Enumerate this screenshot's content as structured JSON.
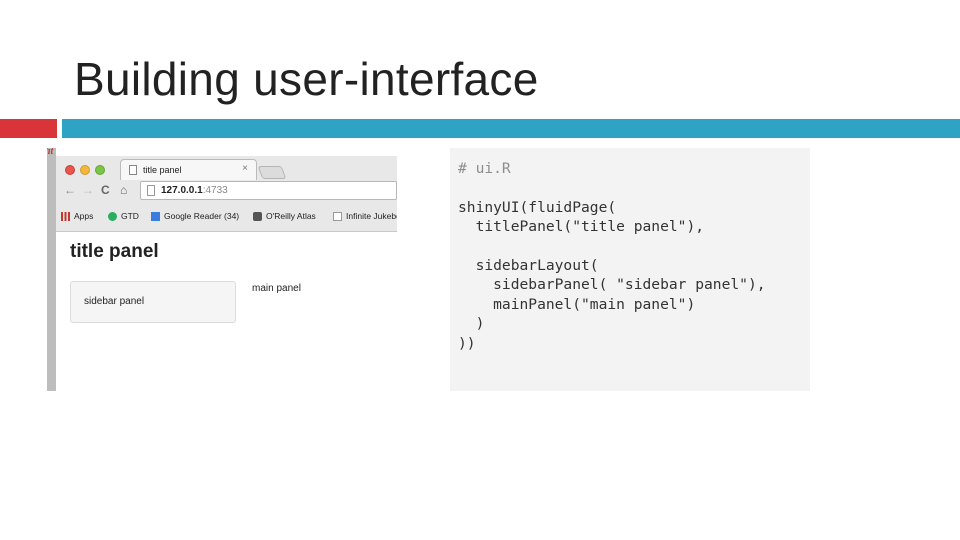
{
  "slide": {
    "title": "Building user-interface"
  },
  "browser": {
    "peek_label": "lit",
    "tab_title": "title panel",
    "tab_close": "×",
    "nav": {
      "back": "←",
      "forward": "→",
      "reload": "C",
      "home": "⌂"
    },
    "url_host": "127.0.0.1",
    "url_port": ":4733",
    "bookmarks": [
      {
        "label": "Apps",
        "icon": "apps-grid-icon"
      },
      {
        "label": "GTD",
        "icon": "gtd-check-icon"
      },
      {
        "label": "Google Reader (34)",
        "icon": "google-reader-icon"
      },
      {
        "label": "O'Reilly Atlas",
        "icon": "oreilly-icon"
      },
      {
        "label": "Infinite Jukebo",
        "icon": "document-icon"
      }
    ],
    "page": {
      "title": "title panel",
      "sidebar_text": "sidebar panel",
      "main_text": "main panel"
    }
  },
  "code": {
    "lines": [
      "# ui.R",
      "",
      "shinyUI(fluidPage(",
      "  titlePanel(\"title panel\"),",
      "",
      "  sidebarLayout(",
      "    sidebarPanel( \"sidebar panel\"),",
      "    mainPanel(\"main panel\")",
      "  )",
      "))"
    ]
  },
  "colors": {
    "accent_red": "#d9343a",
    "accent_blue": "#2fa3c3"
  }
}
